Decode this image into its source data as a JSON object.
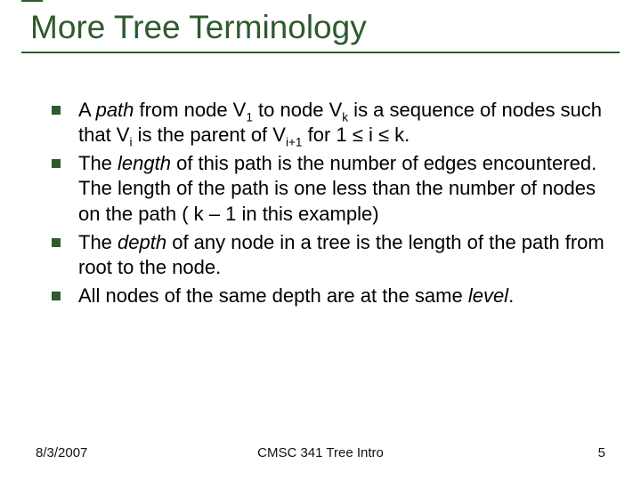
{
  "title": "More Tree Terminology",
  "bullets": [
    {
      "html": "A <span class='it'>path</span> from node V<span class='sub'>1</span> to node V<span class='sub'>k</span> is a sequence of nodes such that V<span class='sub'>i</span> is the parent of V<span class='sub'>i+1</span> for 1 ≤ i ≤ k."
    },
    {
      "html": "The <span class='it'>length</span> of this path is the number of edges encountered.  The length of the path is one less than the number of nodes on the path ( k – 1 in this example)"
    },
    {
      "html": "The <span class='it'>depth</span> of any node in a tree is the length of the path from root to the node."
    },
    {
      "html": "All nodes of the same depth are at the same <span class='it'>level</span>."
    }
  ],
  "footer": {
    "date": "8/3/2007",
    "center": "CMSC 341 Tree Intro",
    "page": "5"
  }
}
